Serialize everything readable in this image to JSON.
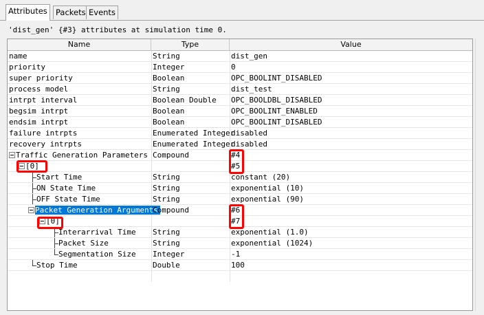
{
  "tabs": [
    {
      "label": "Attributes",
      "active": true
    },
    {
      "label": "Packets",
      "active": false
    },
    {
      "label": "Events",
      "active": false
    }
  ],
  "caption": "'dist_gen' {#3} attributes at simulation time 0.",
  "columns": {
    "name": "Name",
    "type": "Type",
    "value": "Value"
  },
  "rows": [
    {
      "name": "name",
      "type": "String",
      "value": "dist_gen"
    },
    {
      "name": "priority",
      "type": "Integer",
      "value": "0"
    },
    {
      "name": "super priority",
      "type": "Boolean",
      "value": "OPC_BOOLINT_DISABLED"
    },
    {
      "name": "process model",
      "type": "String",
      "value": "dist_test"
    },
    {
      "name": "intrpt interval",
      "type": "Boolean Double",
      "value": "OPC_BOOLDBL_DISABLED"
    },
    {
      "name": "begsim intrpt",
      "type": "Boolean",
      "value": "OPC_BOOLINT_ENABLED"
    },
    {
      "name": "endsim intrpt",
      "type": "Boolean",
      "value": "OPC_BOOLINT_DISABLED"
    },
    {
      "name": "failure intrpts",
      "type": "Enumerated Integer",
      "value": "disabled"
    },
    {
      "name": "recovery intrpts",
      "type": "Enumerated Integer",
      "value": "disabled"
    },
    {
      "name": "Traffic Generation Parameters",
      "type": "Compound",
      "value": "#4"
    },
    {
      "name": "[0]",
      "type": "",
      "value": "#5"
    },
    {
      "name": "Start Time",
      "type": "String",
      "value": "constant (20)"
    },
    {
      "name": "ON State Time",
      "type": "String",
      "value": "exponential (10)"
    },
    {
      "name": "OFF State Time",
      "type": "String",
      "value": "exponential (90)"
    },
    {
      "name": "Packet Generation Arguments",
      "type": "Compound",
      "value": "#6"
    },
    {
      "name": "[0]",
      "type": "",
      "value": "#7"
    },
    {
      "name": "Interarrival Time",
      "type": "String",
      "value": "exponential (1.0)"
    },
    {
      "name": "Packet Size",
      "type": "String",
      "value": "exponential (1024)"
    },
    {
      "name": "Segmentation Size",
      "type": "Integer",
      "value": "-1"
    },
    {
      "name": "Stop Time",
      "type": "Double",
      "value": "100"
    }
  ]
}
